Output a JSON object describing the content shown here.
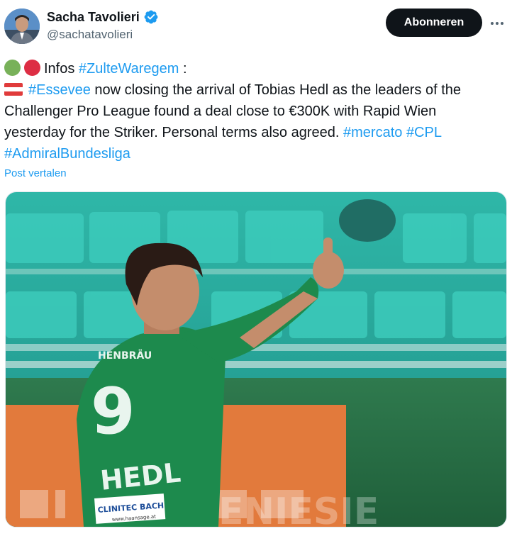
{
  "author": {
    "name": "Sacha Tavolieri",
    "handle": "@sachatavolieri",
    "verified": true,
    "avatar_icon": "person-avatar"
  },
  "actions": {
    "follow_label": "Abonneren",
    "more_icon": "more-horizontal-icon"
  },
  "tweet": {
    "line1": {
      "prefix": "Infos ",
      "hashtag": "#ZulteWaregem",
      "suffix": " :"
    },
    "line2": {
      "hashtag": "#Essevee",
      "text": " now closing the arrival of Tobias Hedl as the leaders of the"
    },
    "line3": "Challenger Pro League found a deal close to €300K with Rapid Wien",
    "line4": {
      "text": "yesterday for the Striker. Personal terms also agreed. ",
      "tags": [
        "#mercato",
        "#CPL"
      ]
    },
    "line5": "#AdmiralBundesliga",
    "emoji": [
      "green-circle",
      "red-circle",
      "austria-flag"
    ],
    "translate_label": "Post vertalen"
  },
  "media": {
    "jersey_number": "9",
    "jersey_name": "HEDL",
    "sponsor_top": "HENBRÄU",
    "sponsor_badge": "CLINITEC BACH",
    "sponsor_url": "www.haansage.at",
    "ad_board_text": "ENIESIE"
  },
  "colors": {
    "accent": "#1d9bf0",
    "button_bg": "#0f1419",
    "green_dot": "#78b159",
    "red_dot": "#dd2e44",
    "jersey": "#1d8a4d"
  }
}
